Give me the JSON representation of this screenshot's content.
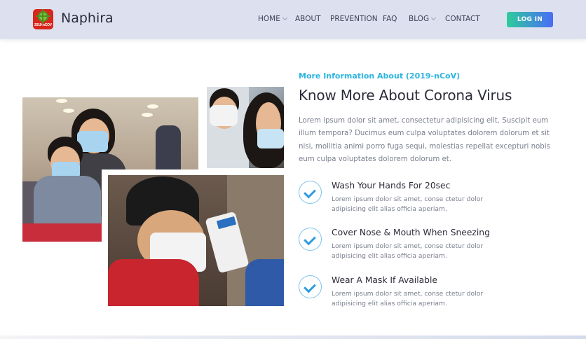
{
  "header": {
    "brand": "Naphira",
    "logo_text": "2019-nCOV",
    "nav": [
      {
        "label": "HOME",
        "has_dropdown": true
      },
      {
        "label": "ABOUT",
        "has_dropdown": false
      },
      {
        "label": "PREVENTION",
        "has_dropdown": false
      },
      {
        "label": "FAQ",
        "has_dropdown": false
      },
      {
        "label": "BLOG",
        "has_dropdown": true
      },
      {
        "label": "CONTACT",
        "has_dropdown": false
      }
    ],
    "login_label": "LOG IN"
  },
  "about": {
    "eyebrow": "More Information About (2019-nCoV)",
    "title": "Know More About Corona Virus",
    "description": "Lorem ipsum dolor sit amet, consectetur adipisicing elit. Suscipit eum illum tempora? Ducimus eum culpa voluptates dolorem dolorum et sit nisi, mollitia animi porro fuga sequi, molestias repellat excepturi nobis eum culpa voluptates dolorem dolorum et.",
    "features": [
      {
        "title": "Wash Your Hands For 20sec",
        "text": "Lorem ipsum dolor sit amet, conse ctetur dolor adipisicing elit alias officia aperiam."
      },
      {
        "title": "Cover Nose & Mouth When Sneezing",
        "text": "Lorem ipsum dolor sit amet, conse ctetur dolor adipisicing elit alias officia aperiam."
      },
      {
        "title": "Wear A Mask If Available",
        "text": "Lorem ipsum dolor sit amet, conse ctetur dolor adipisicing elit alias officia aperiam."
      }
    ]
  },
  "colors": {
    "header_bg": "#dde1ef",
    "accent": "#2bb5e0",
    "check": "#2e9be0",
    "login_gradient_start": "#2ecc9a",
    "login_gradient_end": "#4a6cf7"
  }
}
